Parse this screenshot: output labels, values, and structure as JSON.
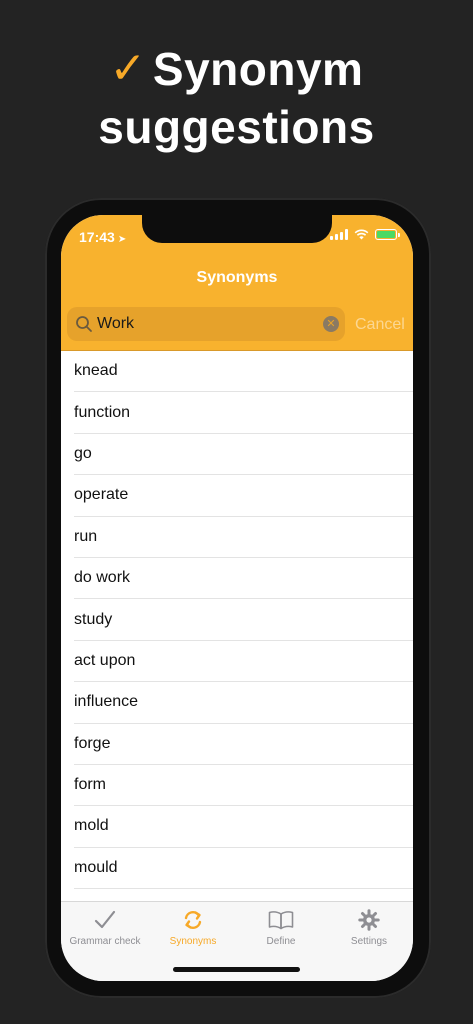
{
  "headline": {
    "line1": "Synonym",
    "line2": "suggestions",
    "check_glyph": "✓"
  },
  "status_bar": {
    "time": "17:43",
    "location_glyph": "➤"
  },
  "nav": {
    "title": "Synonyms"
  },
  "search": {
    "value": "Work",
    "cancel_label": "Cancel"
  },
  "synonyms": [
    "knead",
    "function",
    "go",
    "operate",
    "run",
    "do work",
    "study",
    "act upon",
    "influence",
    "forge",
    "form",
    "mold",
    "mould"
  ],
  "tabs": [
    {
      "label": "Grammar check",
      "icon": "checkmark-icon",
      "active": false
    },
    {
      "label": "Synonyms",
      "icon": "refresh-icon",
      "active": true
    },
    {
      "label": "Define",
      "icon": "book-icon",
      "active": false
    },
    {
      "label": "Settings",
      "icon": "gear-icon",
      "active": false
    }
  ],
  "colors": {
    "accent": "#F8B22E",
    "active_tab": "#F7A928",
    "inactive_tab": "#8e8e93",
    "background": "#232323"
  }
}
